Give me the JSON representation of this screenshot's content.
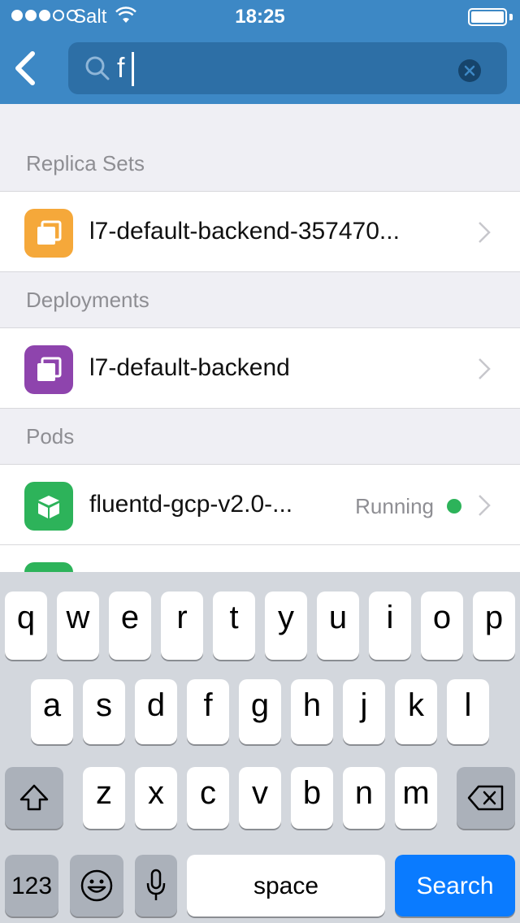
{
  "status_bar": {
    "carrier": "Salt",
    "time": "18:25"
  },
  "search": {
    "value": "f",
    "placeholder": ""
  },
  "sections": [
    {
      "title": "Replica Sets",
      "items": [
        {
          "label": "l7-default-backend-357470...",
          "icon": "replica-set-icon",
          "color": "#f5a83a"
        }
      ]
    },
    {
      "title": "Deployments",
      "items": [
        {
          "label": "l7-default-backend",
          "icon": "deployment-icon",
          "color": "#8e44ad"
        }
      ]
    },
    {
      "title": "Pods",
      "items": [
        {
          "label": "fluentd-gcp-v2.0-...",
          "status": "Running",
          "icon": "pod-icon",
          "color": "#2db35a"
        }
      ]
    }
  ],
  "keyboard": {
    "row1": [
      "q",
      "w",
      "e",
      "r",
      "t",
      "y",
      "u",
      "i",
      "o",
      "p"
    ],
    "row2": [
      "a",
      "s",
      "d",
      "f",
      "g",
      "h",
      "j",
      "k",
      "l"
    ],
    "row3": [
      "z",
      "x",
      "c",
      "v",
      "b",
      "n",
      "m"
    ],
    "numbers_label": "123",
    "space_label": "space",
    "search_label": "Search"
  },
  "colors": {
    "nav": "#3d88c5",
    "search_field": "#2d6fa6",
    "keyboard_bg": "#d3d7dd",
    "search_key": "#0a7bff"
  }
}
